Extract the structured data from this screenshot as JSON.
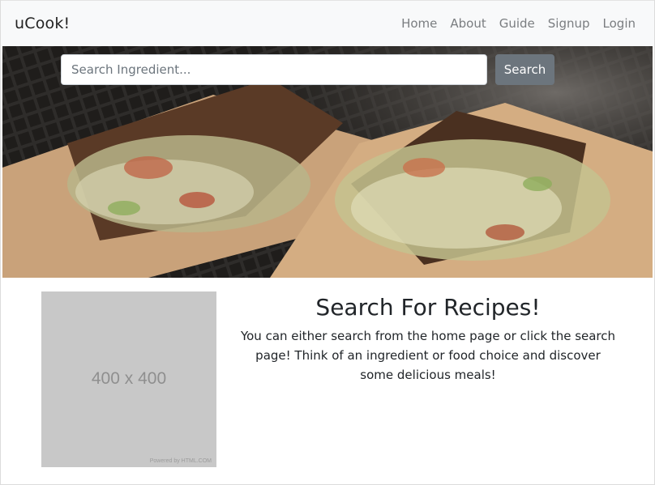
{
  "navbar": {
    "brand": "uCook!",
    "links": [
      {
        "label": "Home"
      },
      {
        "label": "About"
      },
      {
        "label": "Guide"
      },
      {
        "label": "Signup"
      },
      {
        "label": "Login"
      }
    ]
  },
  "hero": {
    "search": {
      "placeholder": "Search Ingredient...",
      "value": "",
      "button_label": "Search"
    }
  },
  "content": {
    "image": {
      "dimensions_text": "400 x 400",
      "powered_by": "Powered by HTML.COM"
    },
    "heading": "Search For Recipes!",
    "body": "You can either search from the home page or click the search page! Think of an ingredient or food choice and discover some delicious meals!"
  },
  "colors": {
    "navbar_bg": "#f8f9fa",
    "search_button": "#6c757d",
    "placeholder_image": "#c8c8c8"
  }
}
